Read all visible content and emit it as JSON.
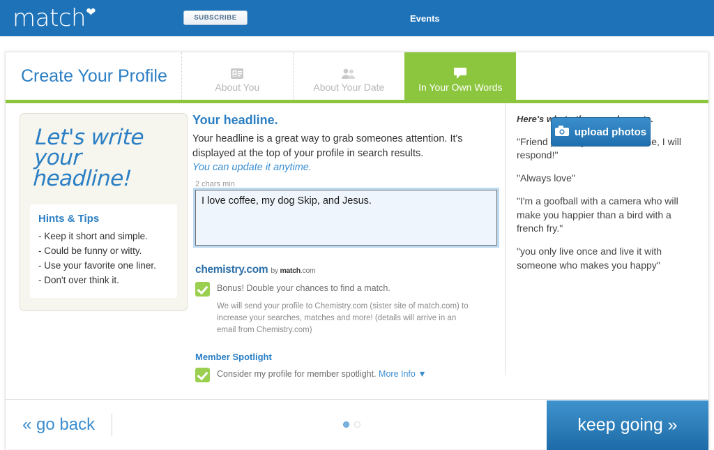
{
  "header": {
    "logo_text": "match",
    "logo_icon": "heart-icon",
    "subscribe_label": "SUBSCRIBE",
    "events_label": "Events",
    "bar_color": "#1e72b8"
  },
  "tabs": {
    "page_title": "Create Your Profile",
    "items": [
      {
        "label": "About You",
        "icon": "id-card-icon",
        "active": false
      },
      {
        "label": "About Your Date",
        "icon": "two-people-icon",
        "active": false
      },
      {
        "label": "In Your Own Words",
        "icon": "speech-bubble-icon",
        "active": true
      }
    ],
    "upload_label": "upload photos",
    "upload_icon": "camera-icon",
    "active_color": "#8cc63e"
  },
  "sidebar": {
    "handwritten_title": "Let's write your headline!",
    "tips_title": "Hints & Tips",
    "tips": [
      "- Keep it short and simple.",
      "- Could be funny or witty.",
      "- Use your favorite one liner.",
      "- Don't over think it."
    ]
  },
  "main": {
    "section_title": "Your headline.",
    "description_line1": "Your headline is a great way to grab someones attention.",
    "description_line2": "It's displayed at the top of your profile in search results.",
    "description_italic": "You can update it anytime.",
    "chars_min_label": "2 chars min",
    "headline_value": "I love coffee, my dog Skip, and Jesus.",
    "headline_placeholder": "",
    "chemistry": {
      "logo_main": "chemistry.com",
      "logo_by": "by",
      "logo_brand": "match",
      "logo_tld": ".com",
      "checked": true,
      "checkbox_label": "Bonus! Double your chances to find a match.",
      "detail": "We will send your profile to Chemistry.com (sister site of match.com) to increase your searches, matches and more! (details will arrive in an email from Chemistry.com)"
    },
    "spotlight": {
      "title": "Member Spotlight",
      "checked": true,
      "checkbox_label": "Consider my profile for member spotlight.",
      "more_info_label": "More Info ▼"
    }
  },
  "examples": {
    "heading": "Here's what other people wrote.",
    "quotes": [
      "\"Friend possibly more. Email me, I will respond!\"",
      "\"Always love\"",
      "\"I'm a goofball with a camera who will make you happier than a bird with a french fry.\"",
      "\"you only live once and live it with someone who makes you happy\""
    ]
  },
  "footer": {
    "go_back_label": "« go back",
    "keep_going_label": "keep going »",
    "pagination": {
      "total": 2,
      "current": 1
    }
  }
}
